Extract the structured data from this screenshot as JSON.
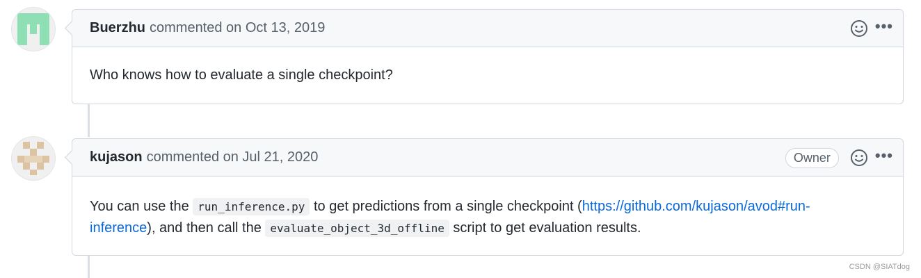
{
  "comments": [
    {
      "author": "Buerzhu",
      "action": "commented on Oct 13, 2019",
      "body": "Who knows how to evaluate a single checkpoint?"
    },
    {
      "author": "kujason",
      "action": "commented on Jul 21, 2020",
      "badge": "Owner",
      "body": {
        "text1": "You can use the ",
        "code1": "run_inference.py",
        "text2": " to get predictions from a single checkpoint (",
        "link": "https://github.com/kujason/avod#run-inference",
        "text3": "), and then call the ",
        "code2": "evaluate_object_3d_offline",
        "text4": " script to get evaluation results."
      }
    }
  ],
  "icons": {
    "emoji": "smiley-icon",
    "more": "kebab-horizontal-icon"
  },
  "more_glyph": "•••",
  "colors": {
    "link": "#0969da",
    "avatar1": "#8ee0b4",
    "avatar2": "#dcc3a2",
    "border": "#d0d7de"
  },
  "watermark": "CSDN @SIATdog"
}
